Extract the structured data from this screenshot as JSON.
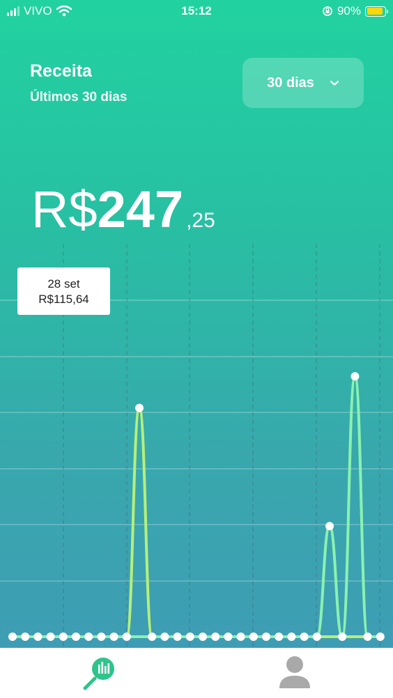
{
  "status_bar": {
    "carrier": "VIVO",
    "time": "15:12",
    "battery": "90%",
    "battery_level": 0.9
  },
  "header": {
    "title": "Receita",
    "subtitle": "Últimos 30 dias"
  },
  "period_select": {
    "label": "30 dias"
  },
  "total": {
    "currency": "R$",
    "integer": "247",
    "decimals": ",25"
  },
  "tooltip": {
    "date": "28 set",
    "value": "R$115,64"
  },
  "colors": {
    "accent_line_1": "#b6ef7a",
    "accent_line_2": "#8af2b0",
    "chart_icon_green": "#2ec48b",
    "avatar_grey": "#a9a9a9"
  },
  "chart_data": {
    "type": "line",
    "days": 30,
    "series": [
      {
        "values": [
          0,
          0,
          0,
          0,
          0,
          0,
          0,
          0,
          0,
          0,
          115.64,
          0,
          0,
          0,
          0,
          0,
          0,
          0,
          0,
          0,
          0,
          0,
          0,
          0,
          0,
          0,
          0,
          0,
          0,
          0
        ]
      },
      {
        "values": [
          0,
          0,
          0,
          0,
          0,
          0,
          0,
          0,
          0,
          0,
          0,
          0,
          0,
          0,
          0,
          0,
          0,
          0,
          0,
          0,
          0,
          0,
          0,
          0,
          0,
          55.9,
          0,
          131.6,
          0,
          0
        ]
      }
    ],
    "grid": true
  },
  "tab_bar": {
    "items": [
      {
        "icon": "bar-chart-icon"
      },
      {
        "icon": "user-icon"
      }
    ]
  }
}
